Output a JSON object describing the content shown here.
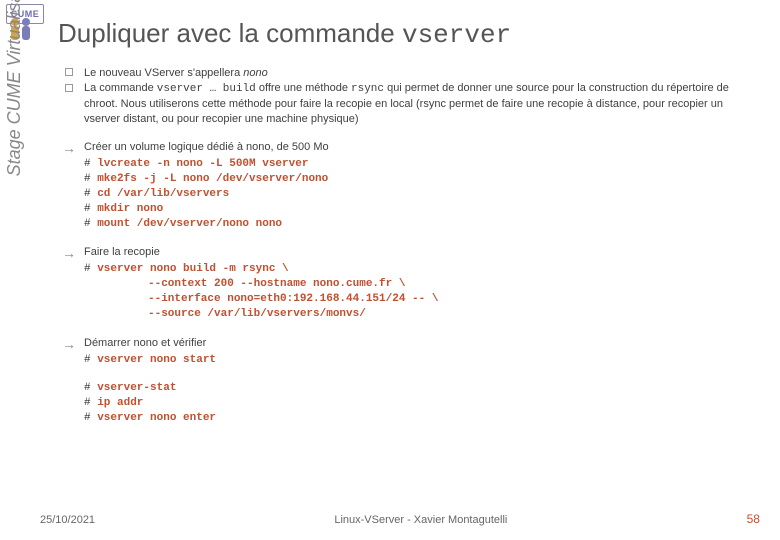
{
  "logo": {
    "text": "CUME"
  },
  "title": {
    "prefix": "Dupliquer avec la commande ",
    "code": "vserver"
  },
  "sidebar": "Stage CUME Virtualisation",
  "blocks": {
    "intro": {
      "line1": {
        "pre": "Le nouveau VServer s'appellera ",
        "em": "nono"
      },
      "line2": {
        "a": "La commande ",
        "b": "vserver … build",
        "c": " offre une méthode ",
        "d": "rsync",
        "e": " qui permet de donner une source pour la construction du répertoire de chroot. Nous utiliserons cette méthode pour faire la recopie en local (rsync permet de faire une recopie à distance, pour recopier un vserver distant, ou pour recopier une machine physique)"
      }
    },
    "vol": {
      "lead": "Créer un volume logique dédié à nono, de 500 Mo",
      "cmds": [
        "lvcreate -n nono -L 500M vserver",
        "mke2fs -j -L nono /dev/vserver/nono",
        "cd /var/lib/vservers",
        "mkdir nono",
        "mount /dev/vserver/nono nono"
      ]
    },
    "copy": {
      "lead": "Faire la recopie",
      "cmd0": "vserver nono build -m rsync \\",
      "cmd_indent": [
        "--context 200 --hostname nono.cume.fr \\",
        "--interface nono=eth0:192.168.44.151/24 -- \\",
        "--source /var/lib/vservers/monvs/"
      ]
    },
    "start": {
      "lead": "Démarrer nono et vérifier",
      "cmd0": "vserver nono start",
      "cmds2": [
        "vserver-stat",
        "ip addr",
        "vserver nono enter"
      ]
    }
  },
  "footer": {
    "date": "25/10/2021",
    "caption": "Linux-VServer - Xavier Montagutelli",
    "page": "58"
  }
}
